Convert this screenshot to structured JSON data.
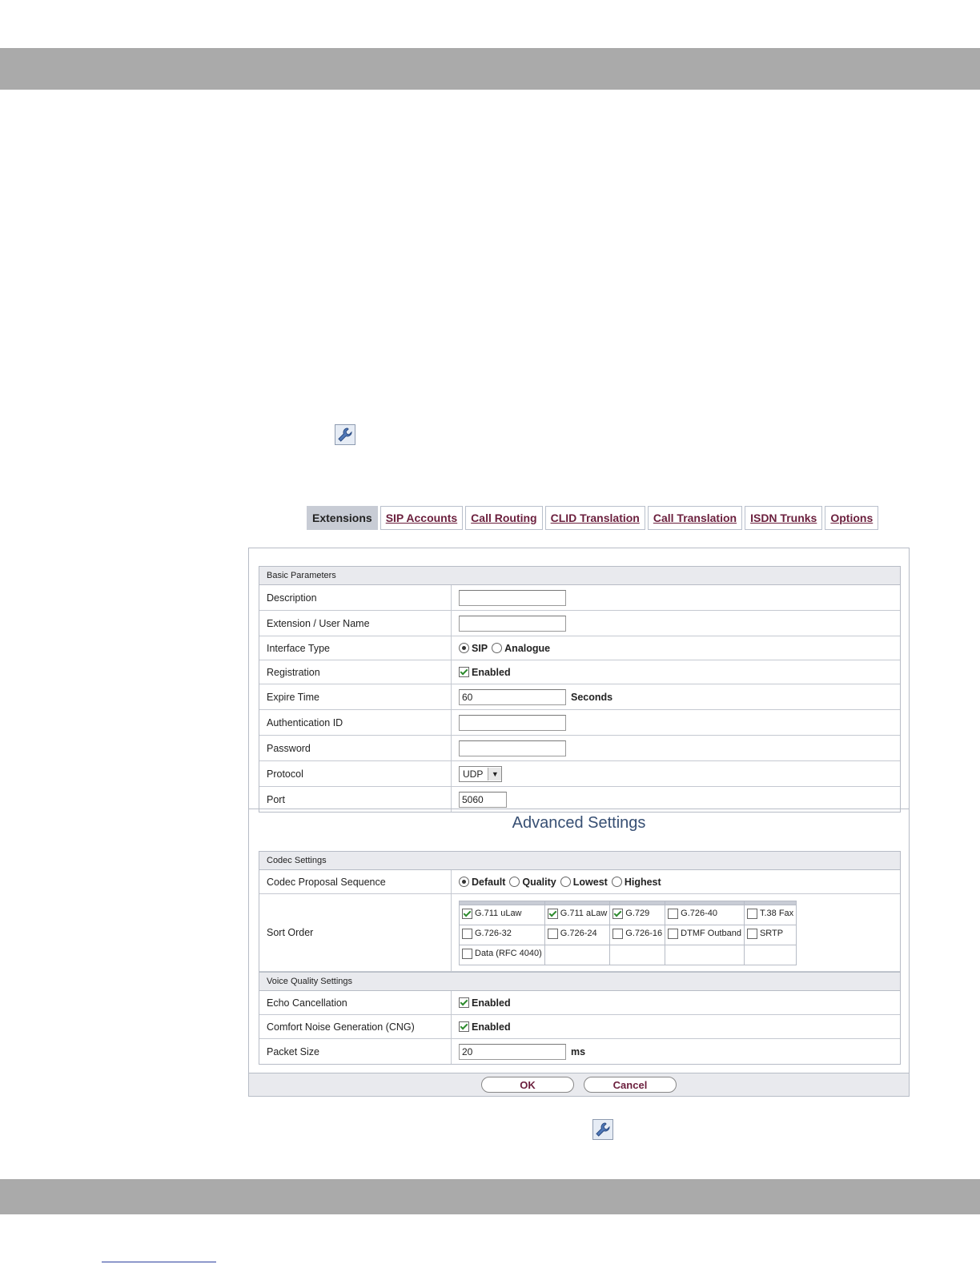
{
  "tabs": [
    "Extensions",
    "SIP Accounts",
    "Call Routing",
    "CLID Translation",
    "Call Translation",
    "ISDN Trunks",
    "Options"
  ],
  "basic": {
    "header": "Basic Parameters",
    "description_label": "Description",
    "description_value": "",
    "extension_label": "Extension / User Name",
    "extension_value": "",
    "interface_label": "Interface Type",
    "interface_sip": "SIP",
    "interface_analogue": "Analogue",
    "registration_label": "Registration",
    "registration_enabled": "Enabled",
    "expire_label": "Expire Time",
    "expire_value": "60",
    "expire_unit": "Seconds",
    "auth_label": "Authentication ID",
    "auth_value": "",
    "password_label": "Password",
    "password_value": "",
    "protocol_label": "Protocol",
    "protocol_value": "UDP",
    "port_label": "Port",
    "port_value": "5060"
  },
  "advanced": {
    "title": "Advanced Settings",
    "codec_header": "Codec Settings",
    "proposal_label": "Codec Proposal Sequence",
    "proposal_options": [
      "Default",
      "Quality",
      "Lowest",
      "Highest"
    ],
    "sort_label": "Sort Order",
    "codecs": {
      "g711u": "G.711 uLaw",
      "g711a": "G.711 aLaw",
      "g729": "G.729",
      "g72640": "G.726-40",
      "t38": "T.38 Fax",
      "g72632": "G.726-32",
      "g72624": "G.726-24",
      "g72616": "G.726-16",
      "dtmf": "DTMF Outband",
      "srtp": "SRTP",
      "data": "Data (RFC 4040)"
    },
    "voice_header": "Voice Quality Settings",
    "echo_label": "Echo Cancellation",
    "echo_enabled": "Enabled",
    "cng_label": "Comfort Noise Generation (CNG)",
    "cng_enabled": "Enabled",
    "packet_label": "Packet Size",
    "packet_value": "20",
    "packet_unit": "ms"
  },
  "buttons": {
    "ok": "OK",
    "cancel": "Cancel"
  },
  "icons": {
    "wrench": "wrench-icon"
  }
}
